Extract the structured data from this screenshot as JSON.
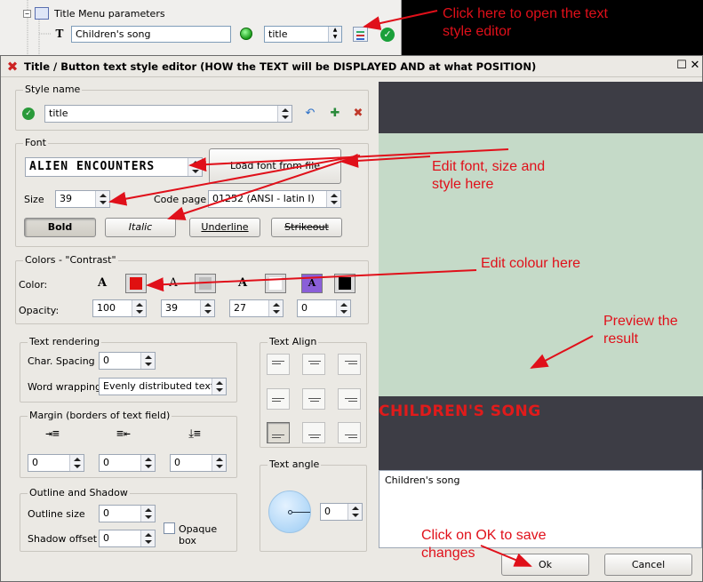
{
  "tree": {
    "header": "Title Menu parameters",
    "text_value": "Children's song",
    "style_value": "title"
  },
  "annotations": {
    "open_editor": [
      "Click here to open the text",
      "style editor"
    ],
    "edit_font": [
      "Edit font, size and",
      "style here"
    ],
    "edit_colour": "Edit colour here",
    "preview": [
      "Preview the",
      "result"
    ],
    "save": [
      "Click on OK to save",
      "changes"
    ]
  },
  "dialog": {
    "title": "Title / Button text style editor  (HOW the TEXT will be DISPLAYED AND at what POSITION)",
    "style_name": {
      "label": "Style name",
      "value": "title"
    },
    "font": {
      "label": "Font",
      "font_name": "ALIEN ENCOUNTERS",
      "load_button": "Load font from file",
      "size_label": "Size",
      "size": "39",
      "code_page_label": "Code page",
      "code_page": "01252 (ANSI - latin I)",
      "bold": "Bold",
      "italic": "Italic",
      "underline": "Underline",
      "strikeout": "Strikeout"
    },
    "colors": {
      "label": "Colors - \"Contrast\"",
      "color_label": "Color:",
      "opacity_label": "Opacity:",
      "opacities": [
        "100",
        "39",
        "27",
        "0"
      ],
      "swatches": [
        "#e01010",
        "#bdbdbd",
        "#ffffff",
        "#8a5fd8",
        "#000000"
      ]
    },
    "text_rendering": {
      "label": "Text rendering",
      "char_spacing_label": "Char. Spacing",
      "char_spacing": "0",
      "word_wrapping_label": "Word wrapping",
      "word_wrapping": "Evenly distributed text"
    },
    "text_align": {
      "label": "Text Align"
    },
    "margin": {
      "label": "Margin  (borders of text field)",
      "values": [
        "0",
        "0",
        "0"
      ]
    },
    "outline": {
      "label": "Outline  and Shadow",
      "outline_size_label": "Outline size",
      "outline_size": "0",
      "shadow_offset_label": "Shadow offset",
      "shadow_offset": "0",
      "opaque_box": "Opaque box"
    },
    "text_angle": {
      "label": "Text angle",
      "value": "0"
    },
    "preview_text": "CHILDREN'S SONG",
    "text_area": "Children's song",
    "ok": "Ok",
    "cancel": "Cancel"
  }
}
